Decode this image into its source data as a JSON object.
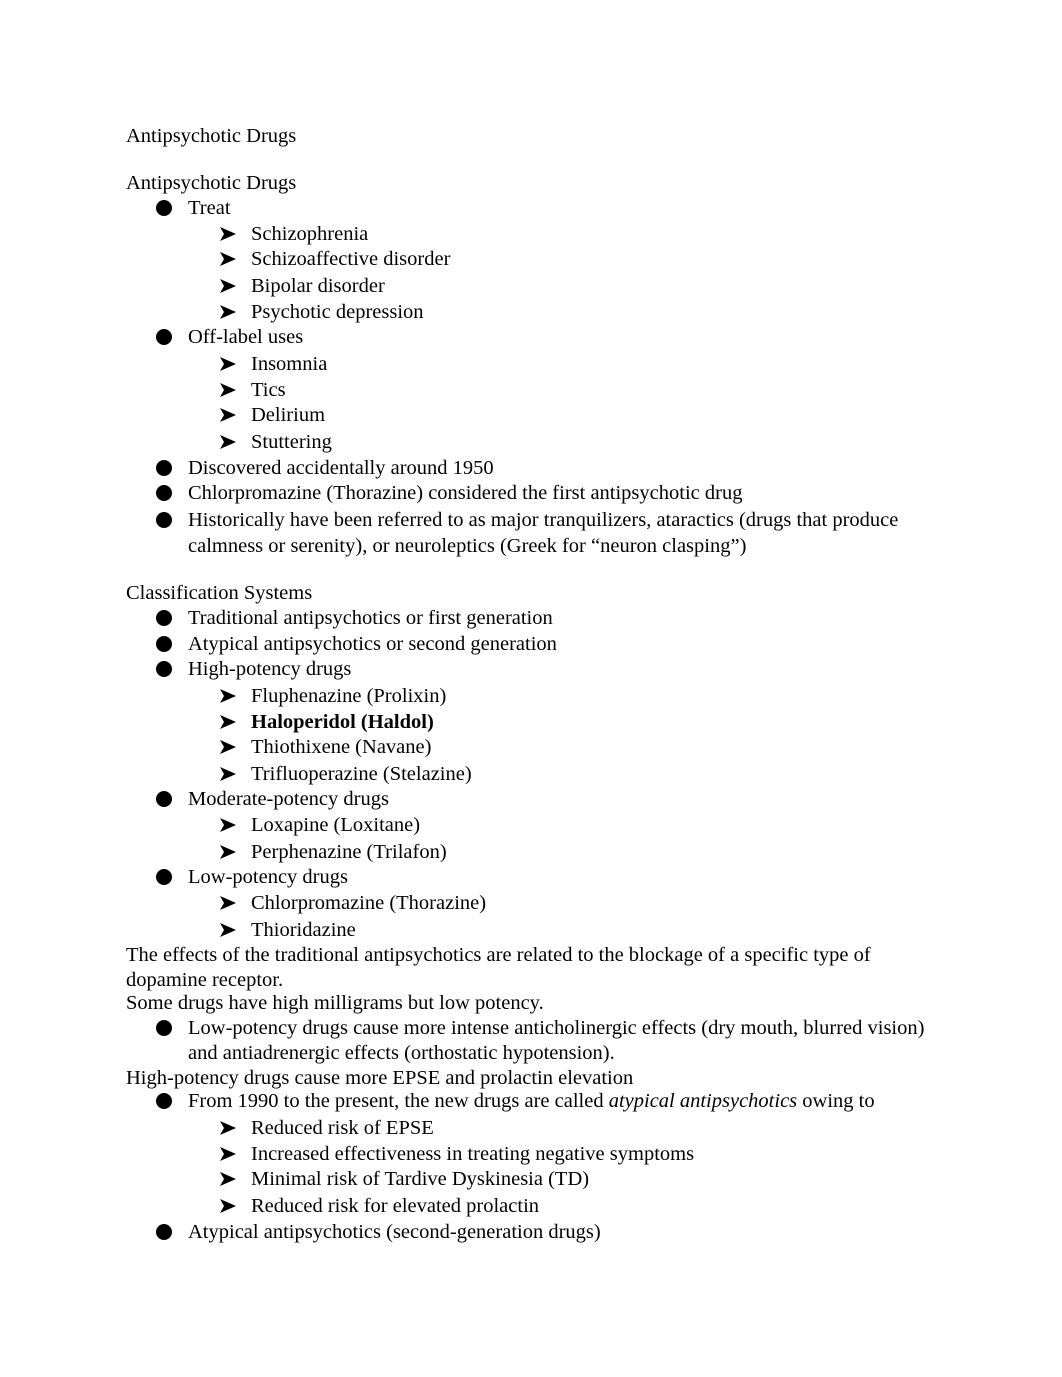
{
  "document": {
    "title": "Antipsychotic Drugs",
    "sections": [
      {
        "heading": "Antipsychotic Drugs",
        "items": [
          {
            "text": "Treat",
            "children": [
              "Schizophrenia",
              "Schizoaffective disorder",
              "Bipolar disorder",
              "Psychotic depression"
            ]
          },
          {
            "text": "Off-label uses",
            "children": [
              "Insomnia",
              "Tics",
              "Delirium",
              "Stuttering"
            ]
          },
          {
            "text": "Discovered accidentally around 1950"
          },
          {
            "text": "Chlorpromazine (Thorazine) considered the first antipsychotic drug"
          },
          {
            "text_line1": "Historically have been referred to as major tranquilizers, ataractics (drugs that produce",
            "text_line2": "calmness or serenity), or neuroleptics (Greek for “neuron clasping”)"
          }
        ]
      },
      {
        "heading": "Classification Systems",
        "items": [
          {
            "text": "Traditional antipsychotics or first generation"
          },
          {
            "text": "Atypical antipsychotics or second generation"
          },
          {
            "text": "High-potency drugs",
            "children": [
              "Fluphenazine (Prolixin)",
              "Haloperidol (Haldol)",
              "Thiothixene (Navane)",
              "Trifluoperazine (Stelazine)"
            ]
          },
          {
            "text": "Moderate-potency drugs",
            "children": [
              "Loxapine (Loxitane)",
              "Perphenazine (Trilafon)"
            ]
          },
          {
            "text": "Low-potency drugs",
            "children": [
              "Chlorpromazine (Thorazine)",
              "Thioridazine"
            ]
          }
        ],
        "para1_line1": "The effects of the traditional antipsychotics are related to the blockage of a specific type of",
        "para1_line2": "dopamine receptor.",
        "para2": "Some drugs have high milligrams but low potency.",
        "low_potency_line1": "Low-potency drugs cause more intense anticholinergic effects (dry mouth, blurred vision)",
        "low_potency_line2": "and antiadrenergic effects (orthostatic hypotension).",
        "para3": "High-potency drugs cause more EPSE and prolactin elevation",
        "atypical_pre": "From 1990 to the present, the new drugs are called ",
        "atypical_em": "atypical antipsychotics",
        "atypical_post": " owing to",
        "atypical_children": [
          "Reduced risk of EPSE",
          "Increased effectiveness in treating negative symptoms",
          "Minimal risk of Tardive Dyskinesia (TD)",
          "Reduced risk for elevated prolactin"
        ],
        "last_item": "Atypical antipsychotics (second-generation drugs)"
      }
    ],
    "bullet_icons": {
      "level1": "filled-circle-bullet",
      "level2": "arrowhead-bullet"
    }
  }
}
